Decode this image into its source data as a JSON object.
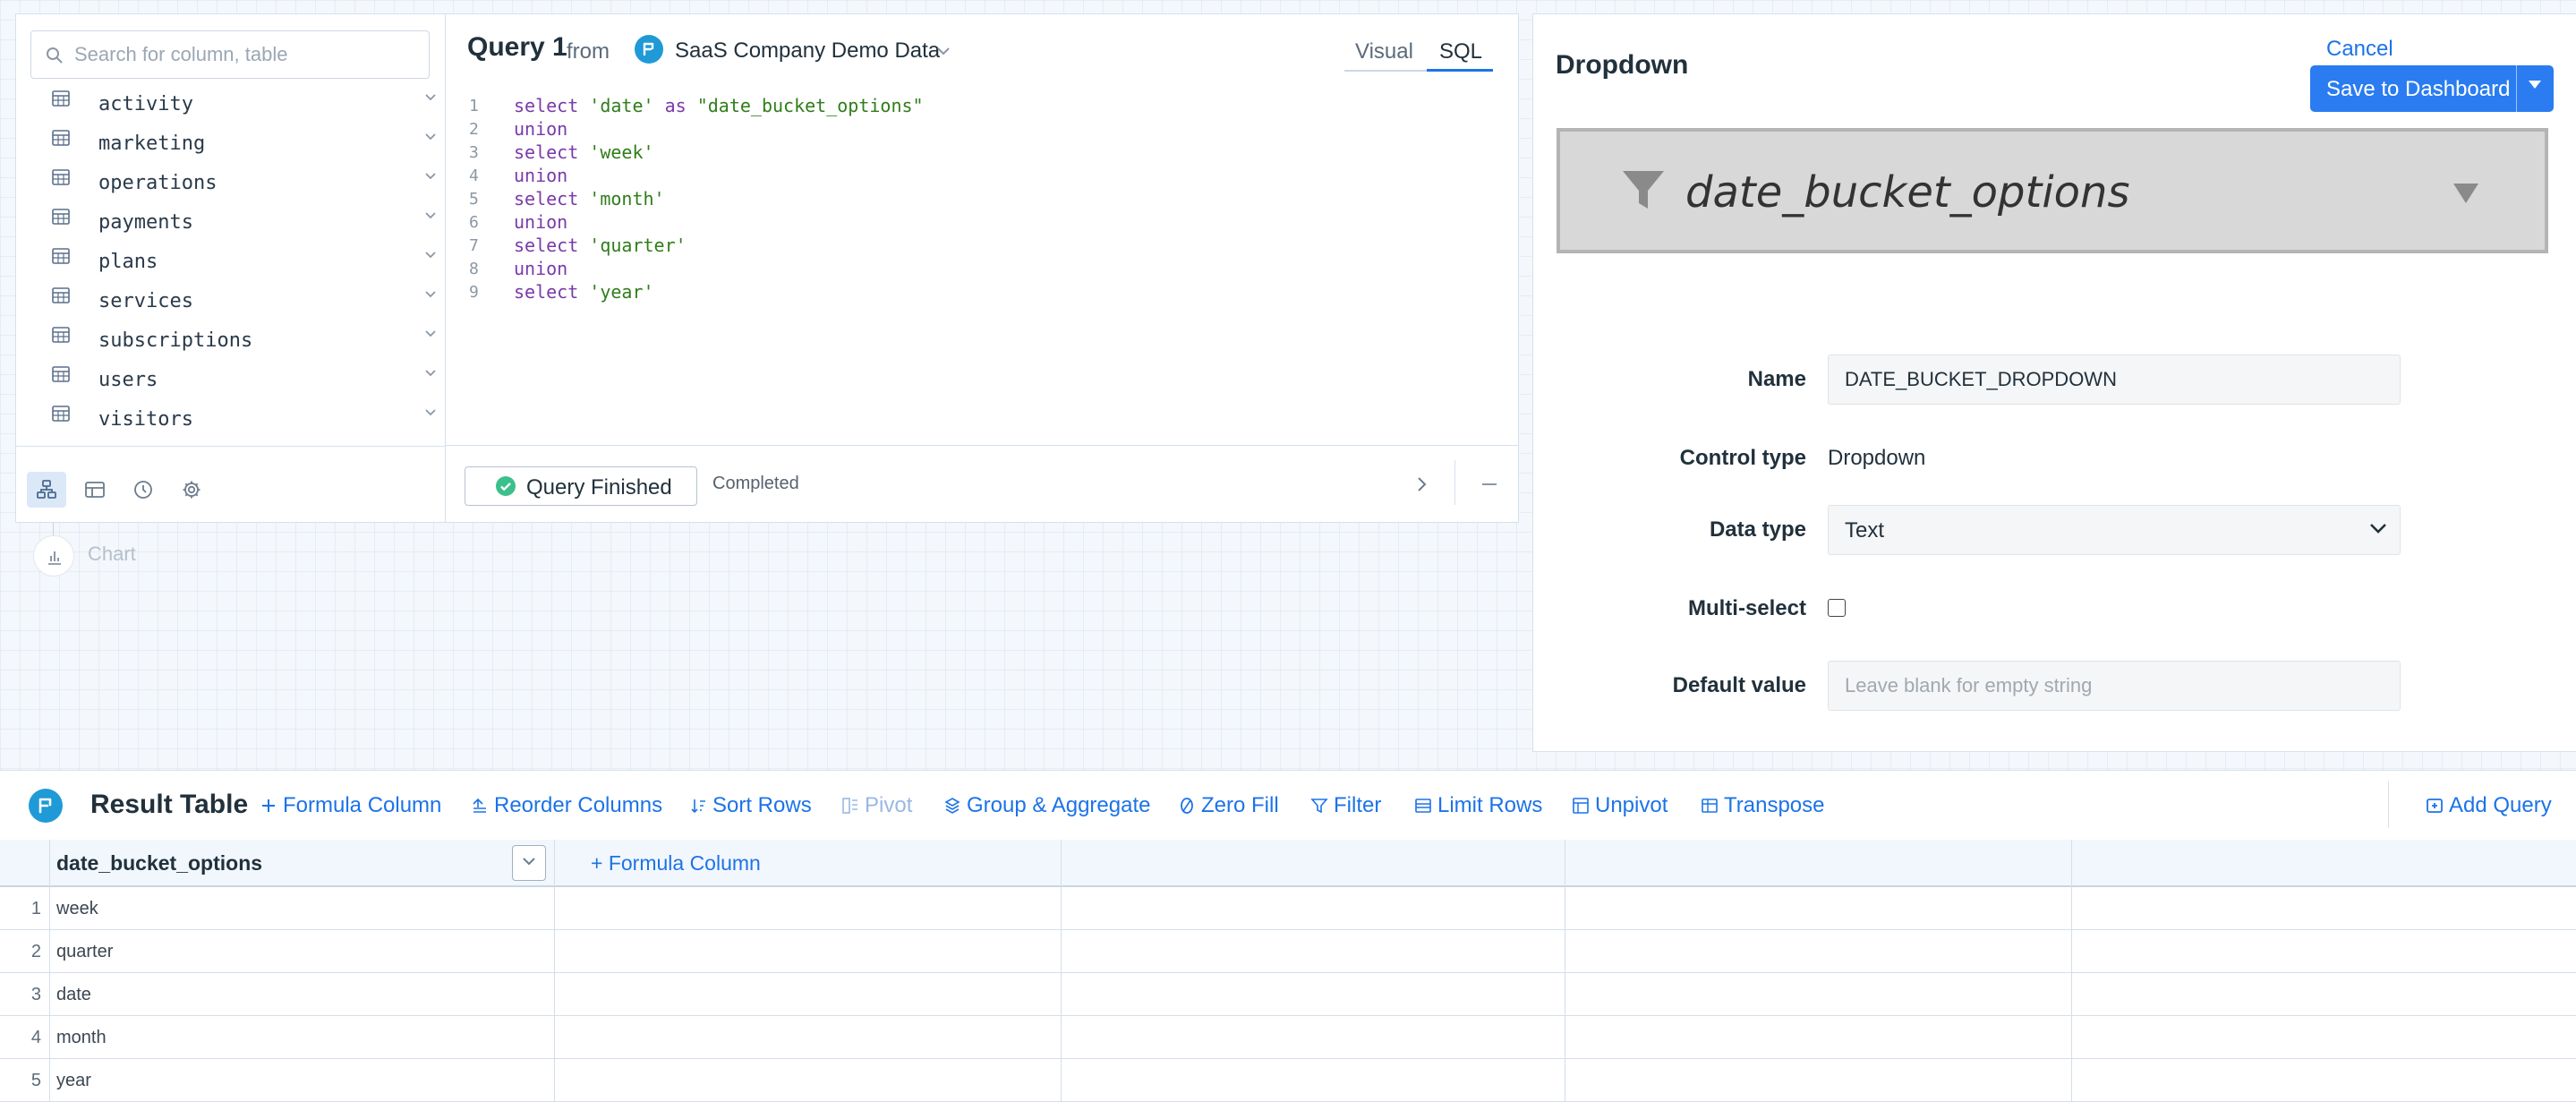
{
  "schema": {
    "search_placeholder": "Search for column, table",
    "tables": [
      {
        "name": "activity"
      },
      {
        "name": "marketing"
      },
      {
        "name": "operations"
      },
      {
        "name": "payments"
      },
      {
        "name": "plans"
      },
      {
        "name": "services"
      },
      {
        "name": "subscriptions"
      },
      {
        "name": "users"
      },
      {
        "name": "visitors"
      }
    ],
    "bottom_icons": [
      "schema-tree-icon",
      "table-icon",
      "history-icon",
      "gear-icon"
    ]
  },
  "query": {
    "title": "Query 1",
    "from_label": "from",
    "datasource": "SaaS Company Demo Data",
    "tabs": [
      "Visual",
      "SQL"
    ],
    "active_tab": "SQL",
    "code": [
      {
        "n": "1",
        "parts": [
          [
            "kw",
            "select "
          ],
          [
            "str",
            "'date'"
          ],
          [
            "kw",
            " as "
          ],
          [
            "str",
            "\"date_bucket_options\""
          ]
        ]
      },
      {
        "n": "2",
        "parts": [
          [
            "kw",
            "union"
          ]
        ]
      },
      {
        "n": "3",
        "parts": [
          [
            "kw",
            "select "
          ],
          [
            "str",
            "'week'"
          ]
        ]
      },
      {
        "n": "4",
        "parts": [
          [
            "kw",
            "union"
          ]
        ]
      },
      {
        "n": "5",
        "parts": [
          [
            "kw",
            "select "
          ],
          [
            "str",
            "'month'"
          ]
        ]
      },
      {
        "n": "6",
        "parts": [
          [
            "kw",
            "union"
          ]
        ]
      },
      {
        "n": "7",
        "parts": [
          [
            "kw",
            "select "
          ],
          [
            "str",
            "'quarter'"
          ]
        ]
      },
      {
        "n": "8",
        "parts": [
          [
            "kw",
            "union"
          ]
        ]
      },
      {
        "n": "9",
        "parts": [
          [
            "kw",
            "select "
          ],
          [
            "str",
            "'year'"
          ]
        ]
      }
    ],
    "status_button": "Query Finished",
    "status_text": "Completed"
  },
  "chart_node": {
    "label": "Chart"
  },
  "control": {
    "title": "Dropdown",
    "cancel": "Cancel",
    "save": "Save to Dashboard",
    "preview_text": "date_bucket_options",
    "fields": {
      "name_label": "Name",
      "name_value": "DATE_BUCKET_DROPDOWN",
      "control_type_label": "Control type",
      "control_type_value": "Dropdown",
      "data_type_label": "Data type",
      "data_type_value": "Text",
      "multi_select_label": "Multi-select",
      "multi_select_checked": false,
      "default_value_label": "Default value",
      "default_value_placeholder": "Leave blank for empty string"
    }
  },
  "result": {
    "title": "Result Table",
    "toolbar": [
      {
        "label": "Formula Column",
        "icon": "plus-icon",
        "enabled": true
      },
      {
        "label": "Reorder Columns",
        "icon": "reorder-icon",
        "enabled": true
      },
      {
        "label": "Sort Rows",
        "icon": "sort-icon",
        "enabled": true
      },
      {
        "label": "Pivot",
        "icon": "pivot-icon",
        "enabled": false
      },
      {
        "label": "Group & Aggregate",
        "icon": "group-icon",
        "enabled": true
      },
      {
        "label": "Zero Fill",
        "icon": "zero-fill-icon",
        "enabled": true
      },
      {
        "label": "Filter",
        "icon": "filter-icon",
        "enabled": true
      },
      {
        "label": "Limit Rows",
        "icon": "limit-icon",
        "enabled": true
      },
      {
        "label": "Unpivot",
        "icon": "unpivot-icon",
        "enabled": true
      },
      {
        "label": "Transpose",
        "icon": "transpose-icon",
        "enabled": true
      }
    ],
    "add_query": "Add Query",
    "column_header": "date_bucket_options",
    "formula_column": "Formula Column",
    "rows": [
      {
        "n": "1",
        "value": "week"
      },
      {
        "n": "2",
        "value": "quarter"
      },
      {
        "n": "3",
        "value": "date"
      },
      {
        "n": "4",
        "value": "month"
      },
      {
        "n": "5",
        "value": "year"
      }
    ]
  },
  "colors": {
    "accent": "#1c73e8",
    "save_button": "#2a7cf0",
    "keyword": "#7a3aa8",
    "string": "#2f7d1a",
    "success": "#3cc08a"
  }
}
